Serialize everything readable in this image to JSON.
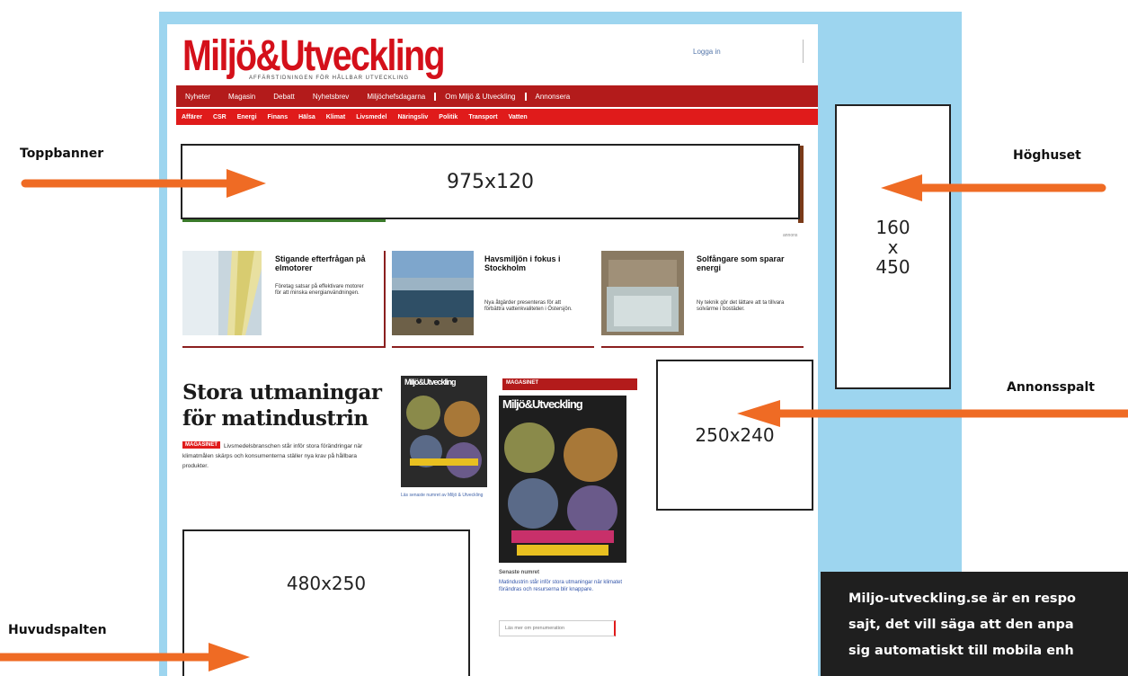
{
  "site": {
    "logo": "Miljö&Utveckling",
    "logo_tagline": "AFFÄRSTIDNINGEN FÖR HÅLLBAR UTVECKLING",
    "login": "Logga in"
  },
  "nav_primary": [
    "Nyheter",
    "Magasin",
    "Debatt",
    "Nyhetsbrev",
    "Miljöchefsdagarna",
    "Om Miljö & Utveckling",
    "Annonsera"
  ],
  "nav_secondary": [
    "Affärer",
    "CSR",
    "Energi",
    "Finans",
    "Hälsa",
    "Klimat",
    "Livsmedel",
    "Näringsliv",
    "Politik",
    "Transport",
    "Vatten"
  ],
  "ads": {
    "top_banner": "975x120",
    "skyscraper": [
      "160",
      "x",
      "450"
    ],
    "sidebar": "250x240",
    "main_column": "480x250"
  },
  "labels": {
    "top_banner": "Toppbanner",
    "skyscraper": "Höghuset",
    "sidebar": "Annonsspalt",
    "main_column": "Huvudspalten"
  },
  "stories": [
    {
      "title": "Stigande efterfrågan på elmotorer",
      "text": "Företag satsar på effektivare motorer för att minska energianvändningen."
    },
    {
      "title": "Havsmiljön i fokus i Stockholm",
      "text": "Nya åtgärder presenteras för att förbättra vattenkvaliteten i Östersjön."
    },
    {
      "title": "Solfångare som sparar energi",
      "text": "Ny teknik gör det lättare att ta tillvara solvärme i bostäder."
    }
  ],
  "feature": {
    "title_line1": "Stora utmaningar",
    "title_line2": "för matindustrin",
    "tag": "MAGASINET",
    "text": "Livsmedelsbranschen står inför stora förändringar när klimatmålen skärps och konsumenterna ställer nya krav på hållbara produkter."
  },
  "magazine": {
    "header": "MAGASINET",
    "cover_title": "Miljö&Utveckling",
    "small_caption": "Läs senaste numret av Miljö & Utveckling",
    "under_heading": "Senaste numret",
    "under_text": "Matindustrin står inför stora utmaningar när klimatet förändras och resurserna blir knappare.",
    "under_link": "Läs mer om prenumeration"
  },
  "info_lines": [
    "Miljo-utveckling.se är en respo",
    "sajt, det vill säga att den anpa",
    "sig automatiskt till mobila enh"
  ],
  "colors": {
    "background_sky": "#9dd5ef",
    "brand_red": "#d4101a",
    "nav_dark_red": "#b31b1b",
    "arrow_orange": "#ef6b24"
  }
}
